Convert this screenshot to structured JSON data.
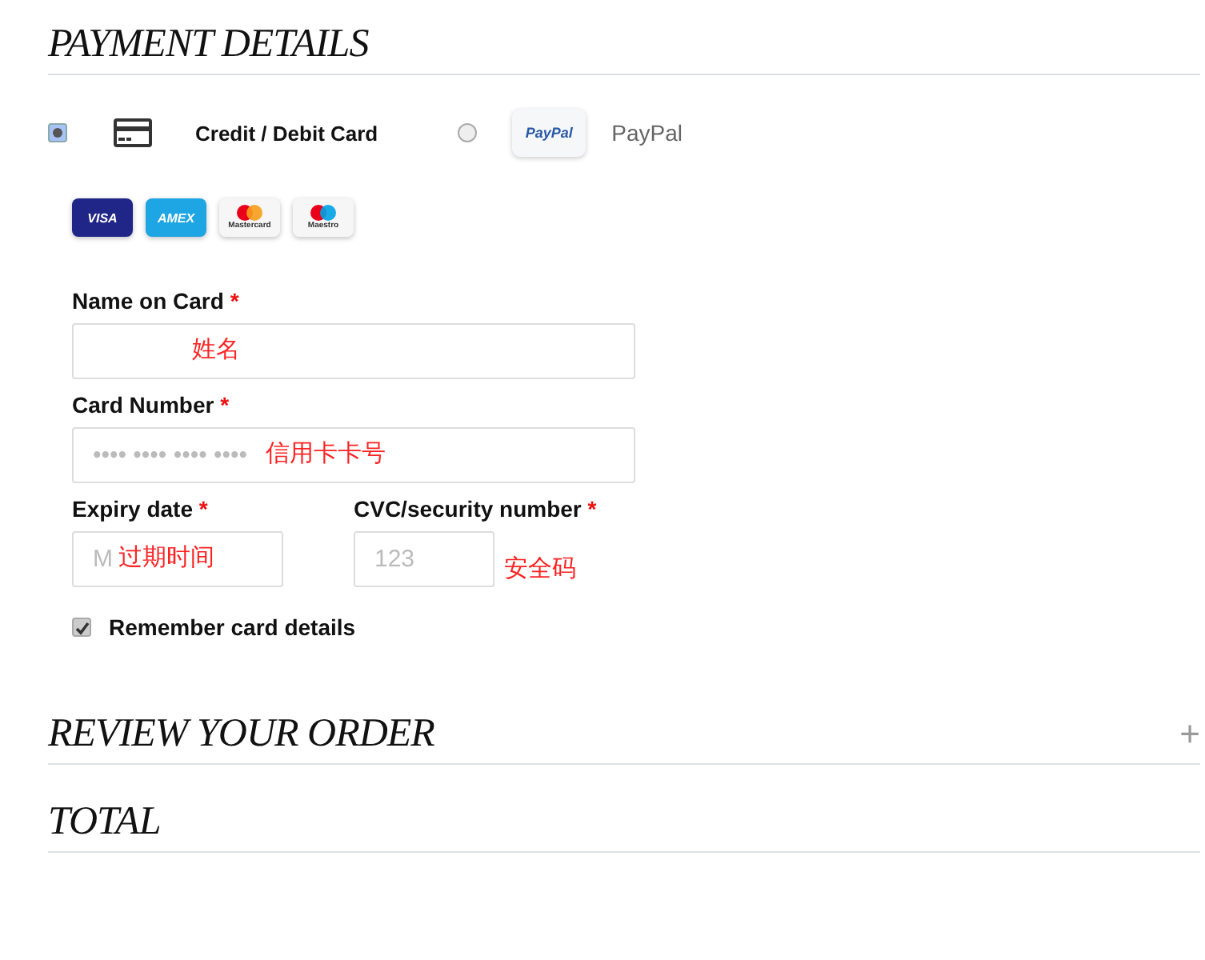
{
  "payment": {
    "title": "PAYMENT DETAILS",
    "methods": [
      {
        "kind": "card",
        "label": "Credit / Debit Card",
        "selected": true
      },
      {
        "kind": "paypal",
        "logo": "PayPal",
        "label": "PayPal",
        "selected": false
      }
    ],
    "brands": [
      {
        "kind": "visa",
        "label": "VISA"
      },
      {
        "kind": "amex",
        "label": "AMEX"
      },
      {
        "kind": "mastercard",
        "label": "Mastercard"
      },
      {
        "kind": "maestro",
        "label": "Maestro"
      }
    ],
    "fields": [
      {
        "label": "Name on Card",
        "required": "*",
        "annotation": "姓名",
        "kind": "wide"
      },
      {
        "label": "Card Number",
        "required": "*",
        "placeholder": "•••• •••• •••• ••••",
        "annotation": "信用卡卡号",
        "kind": "wide"
      },
      {
        "label": "Expiry date",
        "required": "*",
        "placeholder": "M",
        "annotation": "过期时间",
        "kind": "expiry"
      },
      {
        "label": "CVC/security number",
        "required": "*",
        "placeholder": "123",
        "annotation": "安全码",
        "kind": "cvc"
      }
    ],
    "remember": {
      "label": "Remember card details",
      "checked": true
    }
  },
  "sections": [
    {
      "title": "REVIEW YOUR ORDER",
      "toggle": "+"
    },
    {
      "title": "TOTAL"
    }
  ]
}
